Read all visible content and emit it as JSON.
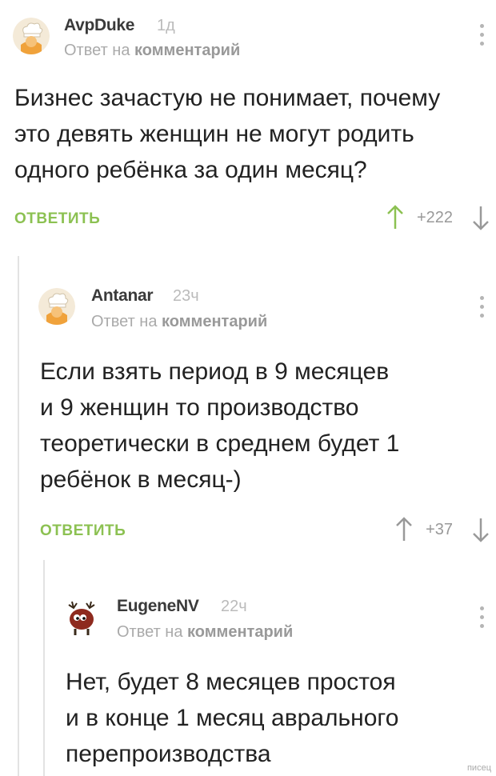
{
  "comments": [
    {
      "author": "AvpDuke",
      "time": "1д",
      "reply_prefix": "Ответ на",
      "reply_target": "комментарий",
      "text": [
        "Бизнес зачастую не понимает, почему",
        "это девять женщин не могут родить",
        "одного ребёнка за один месяц?"
      ],
      "reply_label": "ОТВЕТИТЬ",
      "score": "+222",
      "avatar_icon": "chef-avatar-icon"
    },
    {
      "author": "Antanar",
      "time": "23ч",
      "reply_prefix": "Ответ на",
      "reply_target": "комментарий",
      "text": [
        "Если взять период в 9 месяцев",
        "и 9 женщин то производство",
        "теоретически в среднем будет 1",
        "ребёнок в месяц-)"
      ],
      "reply_label": "ОТВЕТИТЬ",
      "score": "+37",
      "avatar_icon": "chef-avatar-icon"
    },
    {
      "author": "EugeneNV",
      "time": "22ч",
      "reply_prefix": "Ответ на",
      "reply_target": "комментарий",
      "text": [
        "Нет, будет 8 месяцев простоя",
        "и в конце 1 месяц аврального",
        "перепроизводства"
      ],
      "avatar_icon": "reindeer-avatar-icon"
    }
  ],
  "watermark": "писец",
  "colors": {
    "reply_button": "#8cc152",
    "vote_up": "#8cc152",
    "vote_down": "#999999",
    "thread_line": "#e3e3e3"
  }
}
